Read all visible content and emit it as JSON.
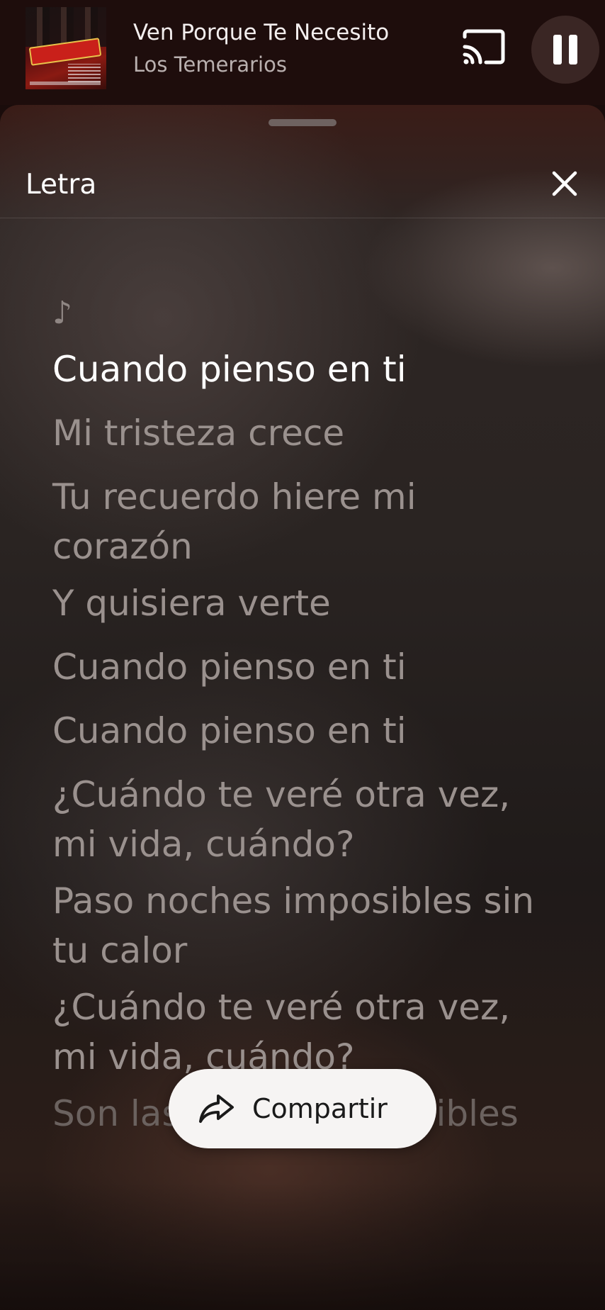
{
  "mini_player": {
    "song_title": "Ven Porque Te Necesito",
    "artist": "Los Temerarios",
    "album_art_icon": "album-cover",
    "cast_icon": "cast-icon",
    "pause_icon": "pause-icon"
  },
  "lyrics_sheet": {
    "title": "Letra",
    "close_icon": "close-icon",
    "intro_symbol": "♪",
    "lines": [
      "Cuando pienso en ti",
      "Mi tristeza crece",
      "Tu recuerdo hiere mi corazón",
      "Y quisiera verte",
      "Cuando pienso en ti",
      "Cuando pienso en ti",
      "¿Cuándo te veré otra vez, mi vida, cuándo?",
      "Paso noches imposibles sin tu calor",
      "¿Cuándo te veré otra vez, mi vida, cuándo?",
      "Son las noches imposibles"
    ],
    "active_line_index": 0
  },
  "share_button": {
    "label": "Compartir",
    "icon": "share-icon"
  },
  "colors": {
    "active_lyric": "#ffffff",
    "inactive_lyric": "#9a918e",
    "share_bg": "#f6f4f3"
  }
}
